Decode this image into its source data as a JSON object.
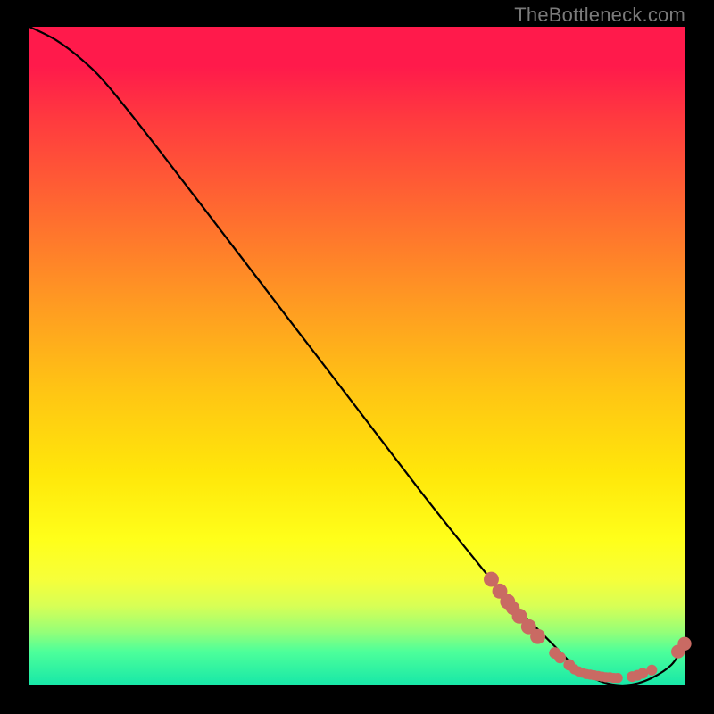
{
  "watermark": "TheBottleneck.com",
  "colors": {
    "curve": "#000000",
    "marker_fill": "#c96a63",
    "marker_stroke": "#a05048"
  },
  "chart_data": {
    "type": "line",
    "title": "",
    "xlabel": "",
    "ylabel": "",
    "xlim": [
      0,
      100
    ],
    "ylim": [
      0,
      100
    ],
    "note": "Axes are implicit (0–100 each). y is bottleneck %, decreasing to ~0 near x≈85 then rising.",
    "series": [
      {
        "name": "bottleneck-curve",
        "x": [
          0,
          4,
          8,
          12,
          20,
          30,
          40,
          50,
          60,
          68,
          73,
          77,
          80,
          83,
          86,
          89,
          92,
          95,
          98,
          100
        ],
        "y": [
          100,
          98,
          95,
          91,
          81,
          68,
          55,
          42,
          29,
          19,
          13,
          9,
          6,
          3,
          1,
          0,
          0,
          1,
          3,
          6
        ]
      }
    ],
    "markers": {
      "note": "salmon dots overlaid on/near the curve in the lower-right region",
      "points": [
        {
          "x": 70.5,
          "y": 16.0,
          "r": 1.6
        },
        {
          "x": 71.8,
          "y": 14.2,
          "r": 1.6
        },
        {
          "x": 73.0,
          "y": 12.6,
          "r": 1.6
        },
        {
          "x": 73.8,
          "y": 11.6,
          "r": 1.4
        },
        {
          "x": 74.8,
          "y": 10.4,
          "r": 1.6
        },
        {
          "x": 76.2,
          "y": 8.8,
          "r": 1.6
        },
        {
          "x": 77.6,
          "y": 7.3,
          "r": 1.6
        },
        {
          "x": 80.2,
          "y": 4.8,
          "r": 1.1
        },
        {
          "x": 81.0,
          "y": 4.1,
          "r": 1.1
        },
        {
          "x": 82.4,
          "y": 3.0,
          "r": 1.1
        },
        {
          "x": 83.2,
          "y": 2.3,
          "r": 0.9
        },
        {
          "x": 83.8,
          "y": 2.0,
          "r": 0.9
        },
        {
          "x": 84.4,
          "y": 1.8,
          "r": 0.9
        },
        {
          "x": 85.0,
          "y": 1.6,
          "r": 0.9
        },
        {
          "x": 85.6,
          "y": 1.5,
          "r": 0.9
        },
        {
          "x": 86.2,
          "y": 1.4,
          "r": 0.9
        },
        {
          "x": 86.8,
          "y": 1.3,
          "r": 0.9
        },
        {
          "x": 87.4,
          "y": 1.2,
          "r": 0.9
        },
        {
          "x": 88.0,
          "y": 1.1,
          "r": 0.9
        },
        {
          "x": 88.6,
          "y": 1.1,
          "r": 0.9
        },
        {
          "x": 89.2,
          "y": 1.0,
          "r": 0.9
        },
        {
          "x": 89.8,
          "y": 1.0,
          "r": 0.9
        },
        {
          "x": 92.0,
          "y": 1.2,
          "r": 1.0
        },
        {
          "x": 92.8,
          "y": 1.4,
          "r": 1.0
        },
        {
          "x": 93.6,
          "y": 1.7,
          "r": 1.0
        },
        {
          "x": 95.0,
          "y": 2.2,
          "r": 1.0
        },
        {
          "x": 99.0,
          "y": 5.0,
          "r": 1.4
        },
        {
          "x": 100.0,
          "y": 6.2,
          "r": 1.4
        }
      ]
    }
  }
}
